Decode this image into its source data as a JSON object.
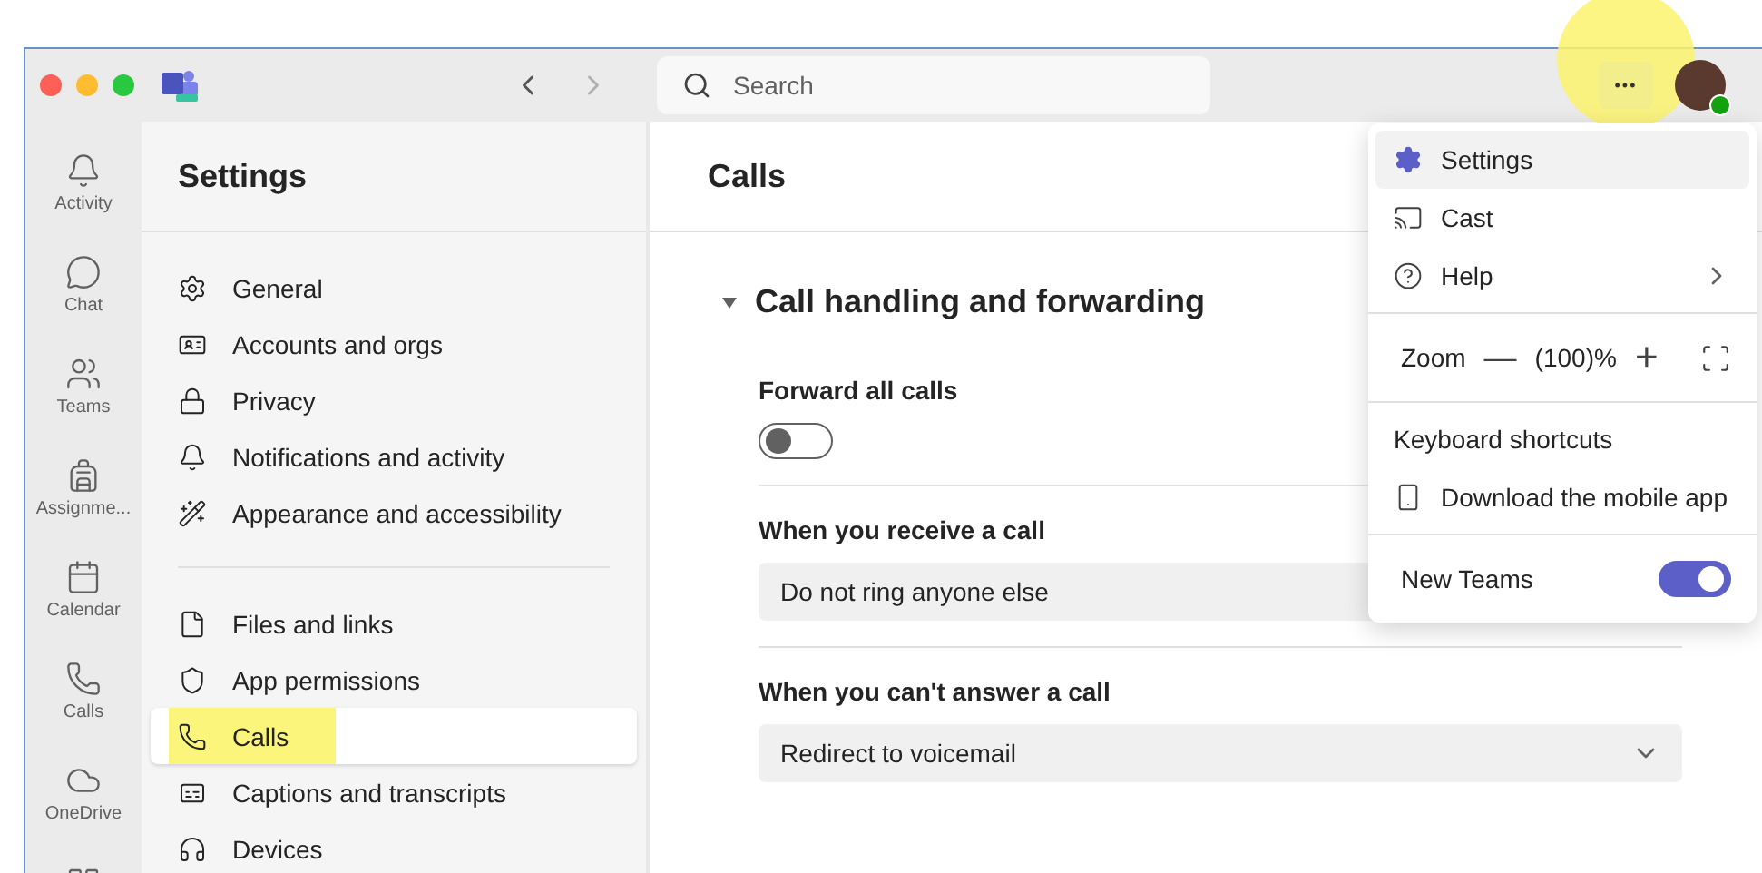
{
  "title_bar": {
    "search": {
      "placeholder": "Search"
    },
    "more_button": {
      "label": "•••",
      "highlighted": true
    }
  },
  "rail": [
    {
      "label": "Activity"
    },
    {
      "label": "Chat"
    },
    {
      "label": "Teams"
    },
    {
      "label": "Assignme..."
    },
    {
      "label": "Calendar"
    },
    {
      "label": "Calls"
    },
    {
      "label": "OneDrive"
    }
  ],
  "settings": {
    "title": "Settings",
    "groups": [
      [
        {
          "label": "General",
          "selected": false
        },
        {
          "label": "Accounts and orgs",
          "selected": false
        },
        {
          "label": "Privacy",
          "selected": false
        },
        {
          "label": "Notifications and activity",
          "selected": false
        },
        {
          "label": "Appearance and accessibility",
          "selected": false
        }
      ],
      [
        {
          "label": "Files and links",
          "selected": false
        },
        {
          "label": "App permissions",
          "selected": false
        },
        {
          "label": "Calls",
          "selected": true,
          "highlighted": true
        },
        {
          "label": "Captions and transcripts",
          "selected": false
        },
        {
          "label": "Devices",
          "selected": false
        }
      ]
    ]
  },
  "content": {
    "title": "Calls",
    "section": {
      "title": "Call handling and forwarding",
      "expanded": true,
      "settings": [
        {
          "kind": "toggle",
          "label": "Forward all calls",
          "on": false
        },
        {
          "kind": "dropdown",
          "label": "When you receive a call",
          "value": "Do not ring anyone else"
        },
        {
          "kind": "dropdown",
          "label": "When you can't answer a call",
          "value": "Redirect to voicemail"
        }
      ]
    }
  },
  "menu": {
    "sections": [
      [
        {
          "kind": "item",
          "label": "Settings",
          "selected": true
        },
        {
          "kind": "item",
          "label": "Cast",
          "selected": false
        },
        {
          "kind": "submenu",
          "label": "Help",
          "selected": false
        }
      ],
      [
        {
          "kind": "zoom",
          "label": "Zoom",
          "value": "(100)%",
          "minus": "—",
          "plus": "+"
        }
      ],
      [
        {
          "kind": "item",
          "label": "Keyboard shortcuts",
          "selected": false
        },
        {
          "kind": "item",
          "label": "Download the mobile app",
          "selected": false
        }
      ],
      [
        {
          "kind": "toggle",
          "label": "New Teams",
          "on": true
        }
      ]
    ]
  }
}
